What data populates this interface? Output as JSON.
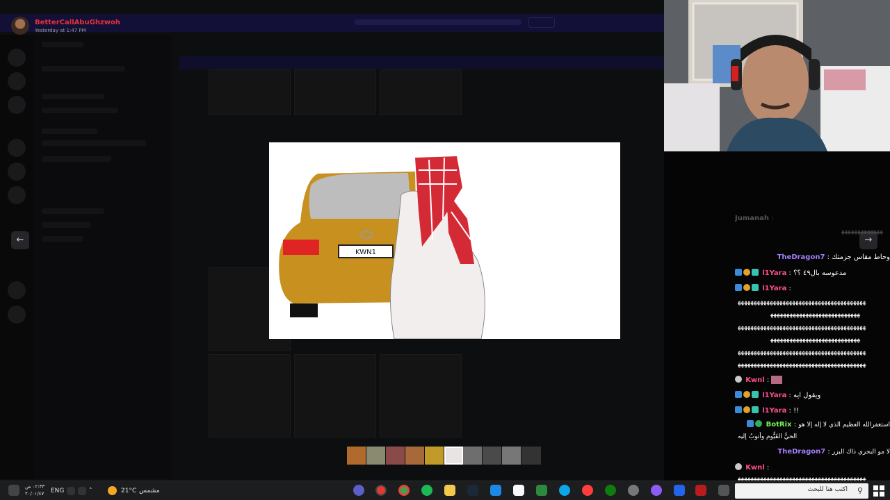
{
  "discord": {
    "banner_text": "",
    "post": {
      "username": "BetterCallAbuGhzwoh",
      "timestamp": "Yesterday at 1:47 PM"
    },
    "prev_icon": "chevron-left-icon",
    "next_icon": "chevron-right-icon",
    "drawing": {
      "plate_text": "KWN1"
    }
  },
  "chat": {
    "messages": [
      {
        "user": "Jumanah",
        "text": "",
        "faded": true
      },
      {
        "user": "",
        "text": "وحاط مقاس جزمتك",
        "name_after": "TheDragon7",
        "color": "#a57dfd"
      },
      {
        "user": "l1Yara",
        "text": "مدعوسه بال٤٩ ؟؟",
        "color": "#ff4e8d",
        "badges": true
      },
      {
        "user": "l1Yara",
        "text": "",
        "color": "#ff4e8d",
        "badges": true
      },
      {
        "user": "Kwnl",
        "text": "",
        "color": "#ff4e8d",
        "emote": true
      },
      {
        "user": "l1Yara",
        "text": "ويقول ايه",
        "color": "#ff4e8d",
        "badges": true
      },
      {
        "user": "l1Yara",
        "text": "!!",
        "color": "#ff4e8d",
        "badges": true
      },
      {
        "user": "BotRix",
        "text": "استغفرالله العظيم الذي لا إله إلا هو",
        "text2": "الحيُّ القَيُّوم وأتوبُ إليه",
        "color": "#7cf55a",
        "badges": true
      },
      {
        "user": "TheDragon7",
        "text": "لا مو البحري ذاك البزر",
        "color": "#a57dfd"
      },
      {
        "user": "Kwnl",
        "text": "",
        "color": "#ff4e8d"
      }
    ],
    "spam": "ﻬﻬﻬﻬﻬﻬﻬﻬﻬﻬﻬﻬﻬﻬﻬﻬﻬﻬﻬﻬﻬﻬﻬﻬﻬﻬﻬﻬﻬﻬﻬﻬﻬﻬﻬﻬﻬﻬﻬﻬ",
    "spam_short": "ﻬﻬﻬﻬﻬﻬﻬﻬﻬﻬﻬﻬﻬﻬﻬﻬﻬﻬﻬﻬﻬﻬﻬﻬﻬﻬﻬﻬ",
    "separator": ":"
  },
  "taskbar": {
    "search_placeholder": "اكتب هنا للبحث",
    "weather_temp": "21°C",
    "weather_desc": "مشمس",
    "lang": "ENG",
    "time": "٠٢:٣٣ ص",
    "date": "٢٠/٠١/٤٧",
    "search_icon": "search-icon",
    "start_icon": "windows-start-icon"
  },
  "colors": {
    "accent_red": "#e8313a",
    "chat_purple": "#a57dfd",
    "chat_pink": "#ff4e8d",
    "chat_green": "#7cf55a",
    "car_gold": "#c8901f",
    "ghutra_red": "#d42a36"
  }
}
